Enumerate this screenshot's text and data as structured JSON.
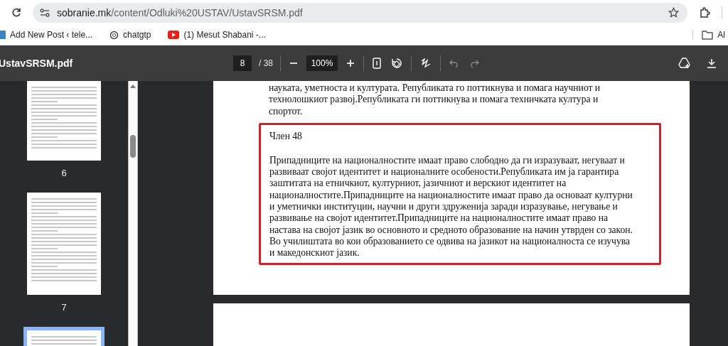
{
  "address_bar": {
    "url_host": "sobranie.mk",
    "url_path": "/content/Odluki%20USTAV/UstavSRSM.pdf"
  },
  "bookmarks": [
    {
      "label": "Add New Post ‹ tele...",
      "kind": "page"
    },
    {
      "label": "chatgtp",
      "kind": "ai"
    },
    {
      "label": "(1) Mesut Shabani -...",
      "kind": "video"
    }
  ],
  "bookmarks_folder": "Al",
  "pdf_toolbar": {
    "filename": "UstavSRSM.pdf",
    "page": "8",
    "page_total": "/ 38",
    "zoom": "100%"
  },
  "thumbnails": [
    {
      "number": "6",
      "selected": false
    },
    {
      "number": "7",
      "selected": false
    },
    {
      "selected": true
    }
  ],
  "document": {
    "top_lines": [
      "науката, уметноста и културата. Републиката го поттикнува и помага научниот и",
      "технолошкиот развој.Републиката ги поттикнува и помага техничката култура и",
      "спортот."
    ],
    "article": {
      "heading": "Член 48",
      "highlighted": true,
      "lines": [
        "Припадниците на националностите имаат право слободно да ги изразуваат, негуваат и",
        "развиваат својот идентитет и националните особености.Републиката им ја гарантира",
        "заштитата на етничкиот, културниот, јазичниот и верскиот идентитет на",
        "националностите.Припадниците на националностите имаат право да основаат културни",
        "и уметнички институции, научни и други здруженија заради изразување, негување и",
        "развивање на својот идентитет.Припадниците на националностите имаат право на",
        "настава на својот јазик во основното и средното образование на начин утврден со закон.",
        "Во училиштата во кои образованието се одвива на јазикот на националноста се изучува",
        "и македонскиот јазик."
      ]
    }
  }
}
